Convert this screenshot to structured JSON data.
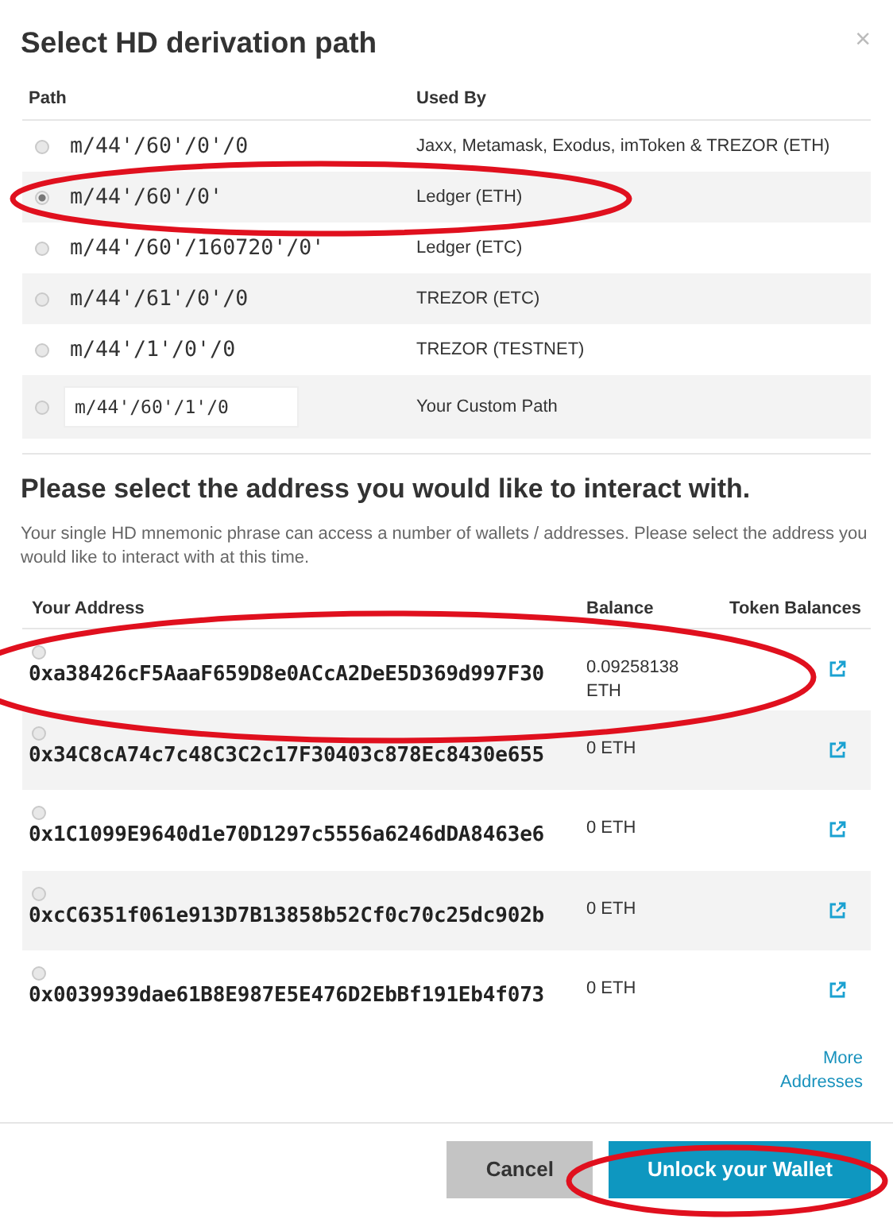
{
  "dialog": {
    "title": "Select HD derivation path",
    "close": "×"
  },
  "path_table": {
    "columns": [
      "Path",
      "Used By"
    ],
    "rows": [
      {
        "path": "m/44'/60'/0'/0",
        "used_by": "Jaxx, Metamask, Exodus, imToken & TREZOR (ETH)",
        "selected": false,
        "kind": "fixed"
      },
      {
        "path": "m/44'/60'/0'",
        "used_by": "Ledger (ETH)",
        "selected": true,
        "kind": "fixed"
      },
      {
        "path": "m/44'/60'/160720'/0'",
        "used_by": "Ledger (ETC)",
        "selected": false,
        "kind": "fixed"
      },
      {
        "path": "m/44'/61'/0'/0",
        "used_by": "TREZOR (ETC)",
        "selected": false,
        "kind": "fixed"
      },
      {
        "path": "m/44'/1'/0'/0",
        "used_by": "TREZOR (TESTNET)",
        "selected": false,
        "kind": "fixed"
      },
      {
        "path": "m/44'/60'/1'/0",
        "used_by": "Your Custom Path",
        "selected": false,
        "kind": "custom"
      }
    ]
  },
  "address_section": {
    "heading": "Please select the address you would like to interact with.",
    "description": "Your single HD mnemonic phrase can access a number of wallets / addresses. Please select the address you would like to interact with at this time.",
    "columns": [
      "Your Address",
      "Balance",
      "Token Balances"
    ],
    "rows": [
      {
        "address": "0xa38426cF5AaaF659D8e0ACcA2DeE5D369d997F30",
        "balance": "0.09258138 ETH",
        "selected": false
      },
      {
        "address": "0x34C8cA74c7c48C3C2c17F30403c878Ec8430e655",
        "balance": "0 ETH",
        "selected": false
      },
      {
        "address": "0x1C1099E9640d1e70D1297c5556a6246dDA8463e6",
        "balance": "0 ETH",
        "selected": false
      },
      {
        "address": "0xcC6351f061e913D7B13858b52Cf0c70c25dc902b",
        "balance": "0 ETH",
        "selected": false
      },
      {
        "address": "0x0039939dae61B8E987E5E476D2EbBf191Eb4f073",
        "balance": "0 ETH",
        "selected": false
      }
    ],
    "more_link": "More Addresses"
  },
  "buttons": [
    {
      "label": "Cancel",
      "kind": "secondary"
    },
    {
      "label": "Unlock your Wallet",
      "kind": "primary"
    }
  ],
  "annotations": [
    {
      "kind": "ellipse"
    },
    {
      "kind": "ellipse"
    },
    {
      "kind": "ellipse"
    }
  ]
}
